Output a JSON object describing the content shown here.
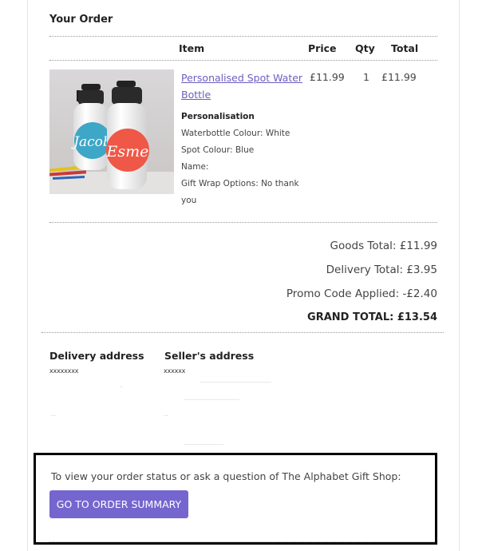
{
  "order": {
    "title": "Your Order",
    "columns": {
      "item": "Item",
      "price": "Price",
      "qty": "Qty",
      "total": "Total"
    },
    "product": {
      "name": "Personalised Spot Water Bottle",
      "price": "£11.99",
      "qty": "1",
      "total": "£11.99",
      "image_text_left": "Jacob",
      "image_text_right": "Esme",
      "personalisation_title": "Personalisation",
      "personalisation": [
        "Waterbottle Colour: White",
        "Spot Colour: Blue",
        "Name:",
        "Gift Wrap Options: No thank",
        "you"
      ]
    }
  },
  "totals": {
    "goods": "Goods Total: £11.99",
    "delivery": "Delivery Total: £3.95",
    "promo": "Promo Code Applied: -£2.40",
    "grand": "GRAND TOTAL: £13.54"
  },
  "addresses": {
    "delivery_title": "Delivery address",
    "delivery_value": "xxxxxxxx",
    "seller_title": "Seller's address",
    "seller_value": "xxxxxx"
  },
  "cta": {
    "text": "To view your order status or ask a question of The Alphabet Gift Shop:",
    "button": "GO TO ORDER SUMMARY",
    "button_color": "#7566cf"
  },
  "colors": {
    "link": "#6b5fbf",
    "text": "#444444",
    "frame": "#000000"
  }
}
